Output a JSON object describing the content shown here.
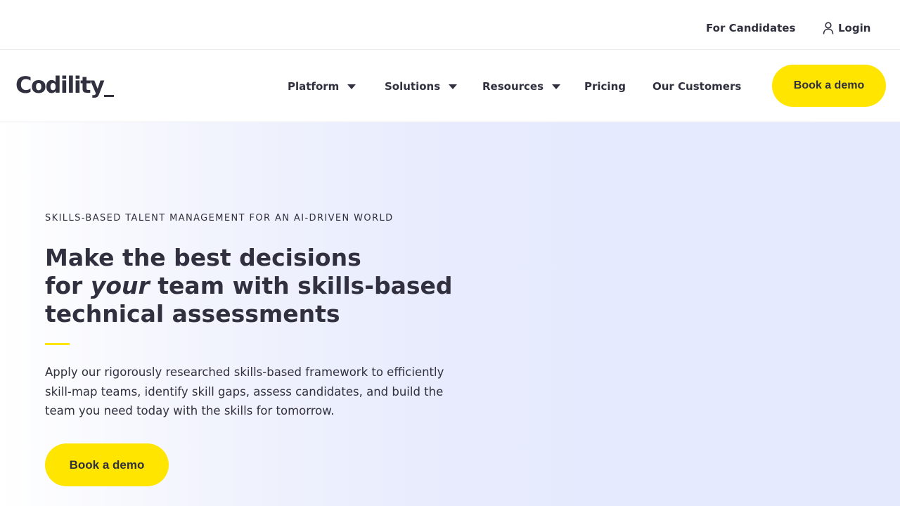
{
  "topbar": {
    "candidates_label": "For Candidates",
    "login_label": "Login",
    "login_icon": "user-icon"
  },
  "brand": {
    "logo_text": "Codility"
  },
  "nav": {
    "items": [
      {
        "label": "Platform",
        "has_dropdown": true
      },
      {
        "label": "Solutions",
        "has_dropdown": true
      },
      {
        "label": "Resources",
        "has_dropdown": true
      },
      {
        "label": "Pricing",
        "has_dropdown": false
      },
      {
        "label": "Our Customers",
        "has_dropdown": false
      }
    ],
    "cta_label": "Book a demo"
  },
  "hero": {
    "eyebrow": "SKILLS-BASED TALENT MANAGEMENT FOR AN AI-DRIVEN WORLD",
    "headline_line1": "Make the best decisions",
    "headline_for": "for",
    "headline_emphasis": "your",
    "headline_line2_rest": "team with skills-based",
    "headline_line3": "technical assessments",
    "description": "Apply our rigorously researched skills-based framework to efficiently skill-map teams, identify skill gaps, assess candidates, and build the team you need today with the skills for tomorrow.",
    "cta_label": "Book a demo"
  },
  "colors": {
    "accent_yellow": "#ffe500",
    "text_dark": "#30303f",
    "hero_background": "#e5e9fe"
  }
}
